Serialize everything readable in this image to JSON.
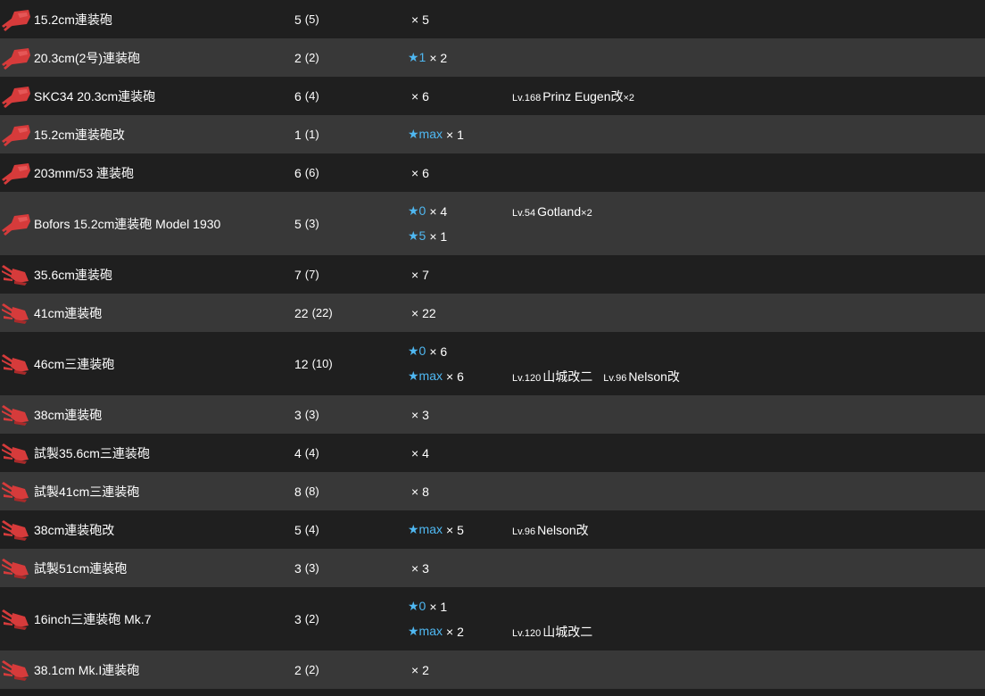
{
  "colors": {
    "star": "#4fb8f2",
    "icon_red": "#d63b3b",
    "row_dark": "#1f1f1f",
    "row_light": "#383838"
  },
  "rows": [
    {
      "icon": "medium-gun-icon",
      "name": "15.2cm連装砲",
      "count": "5",
      "count_sub": "(5)",
      "improvements": [
        {
          "star": "",
          "qty": "× 5"
        }
      ],
      "ships": []
    },
    {
      "icon": "medium-gun-icon",
      "name": "20.3cm(2号)連装砲",
      "count": "2",
      "count_sub": "(2)",
      "improvements": [
        {
          "star": "★1",
          "qty": "× 2"
        }
      ],
      "ships": []
    },
    {
      "icon": "medium-gun-icon",
      "name": "SKC34 20.3cm連装砲",
      "count": "6",
      "count_sub": "(4)",
      "improvements": [
        {
          "star": "",
          "qty": "× 6"
        }
      ],
      "ships": [
        {
          "lv": "Lv.168",
          "name": "Prinz Eugen改",
          "mult": "×2",
          "line": 0
        }
      ]
    },
    {
      "icon": "medium-gun-icon",
      "name": "15.2cm連装砲改",
      "count": "1",
      "count_sub": "(1)",
      "improvements": [
        {
          "star": "★max",
          "qty": "× 1"
        }
      ],
      "ships": []
    },
    {
      "icon": "medium-gun-icon",
      "name": "203mm/53 連装砲",
      "count": "6",
      "count_sub": "(6)",
      "improvements": [
        {
          "star": "",
          "qty": "× 6"
        }
      ],
      "ships": []
    },
    {
      "icon": "medium-gun-icon",
      "name": "Bofors 15.2cm連装砲 Model 1930",
      "count": "5",
      "count_sub": "(3)",
      "improvements": [
        {
          "star": "★0",
          "qty": "× 4"
        },
        {
          "star": "★5",
          "qty": "× 1"
        }
      ],
      "ships": [
        {
          "lv": "Lv.54",
          "name": "Gotland",
          "mult": "×2",
          "line": 0
        }
      ]
    },
    {
      "icon": "large-gun-icon",
      "name": "35.6cm連装砲",
      "count": "7",
      "count_sub": "(7)",
      "improvements": [
        {
          "star": "",
          "qty": "× 7"
        }
      ],
      "ships": []
    },
    {
      "icon": "large-gun-icon",
      "name": "41cm連装砲",
      "count": "22",
      "count_sub": "(22)",
      "improvements": [
        {
          "star": "",
          "qty": "× 22"
        }
      ],
      "ships": []
    },
    {
      "icon": "large-gun-icon",
      "name": "46cm三連装砲",
      "count": "12",
      "count_sub": "(10)",
      "improvements": [
        {
          "star": "★0",
          "qty": "× 6"
        },
        {
          "star": "★max",
          "qty": "× 6"
        }
      ],
      "ships": [
        {
          "lv": "Lv.120",
          "name": "山城改二",
          "mult": "",
          "line": 1
        },
        {
          "lv": "Lv.96",
          "name": "Nelson改",
          "mult": "",
          "line": 1
        }
      ]
    },
    {
      "icon": "large-gun-icon",
      "name": "38cm連装砲",
      "count": "3",
      "count_sub": "(3)",
      "improvements": [
        {
          "star": "",
          "qty": "× 3"
        }
      ],
      "ships": []
    },
    {
      "icon": "large-gun-icon",
      "name": "試製35.6cm三連装砲",
      "count": "4",
      "count_sub": "(4)",
      "improvements": [
        {
          "star": "",
          "qty": "× 4"
        }
      ],
      "ships": []
    },
    {
      "icon": "large-gun-icon",
      "name": "試製41cm三連装砲",
      "count": "8",
      "count_sub": "(8)",
      "improvements": [
        {
          "star": "",
          "qty": "× 8"
        }
      ],
      "ships": []
    },
    {
      "icon": "large-gun-icon",
      "name": "38cm連装砲改",
      "count": "5",
      "count_sub": "(4)",
      "improvements": [
        {
          "star": "★max",
          "qty": "× 5"
        }
      ],
      "ships": [
        {
          "lv": "Lv.96",
          "name": "Nelson改",
          "mult": "",
          "line": 0
        }
      ]
    },
    {
      "icon": "large-gun-icon",
      "name": "試製51cm連装砲",
      "count": "3",
      "count_sub": "(3)",
      "improvements": [
        {
          "star": "",
          "qty": "× 3"
        }
      ],
      "ships": []
    },
    {
      "icon": "large-gun-icon",
      "name": "16inch三連装砲 Mk.7",
      "count": "3",
      "count_sub": "(2)",
      "improvements": [
        {
          "star": "★0",
          "qty": "× 1"
        },
        {
          "star": "★max",
          "qty": "× 2"
        }
      ],
      "ships": [
        {
          "lv": "Lv.120",
          "name": "山城改二",
          "mult": "",
          "line": 1
        }
      ]
    },
    {
      "icon": "large-gun-icon",
      "name": "38.1cm Mk.I連装砲",
      "count": "2",
      "count_sub": "(2)",
      "improvements": [
        {
          "star": "",
          "qty": "× 2"
        }
      ],
      "ships": []
    }
  ]
}
